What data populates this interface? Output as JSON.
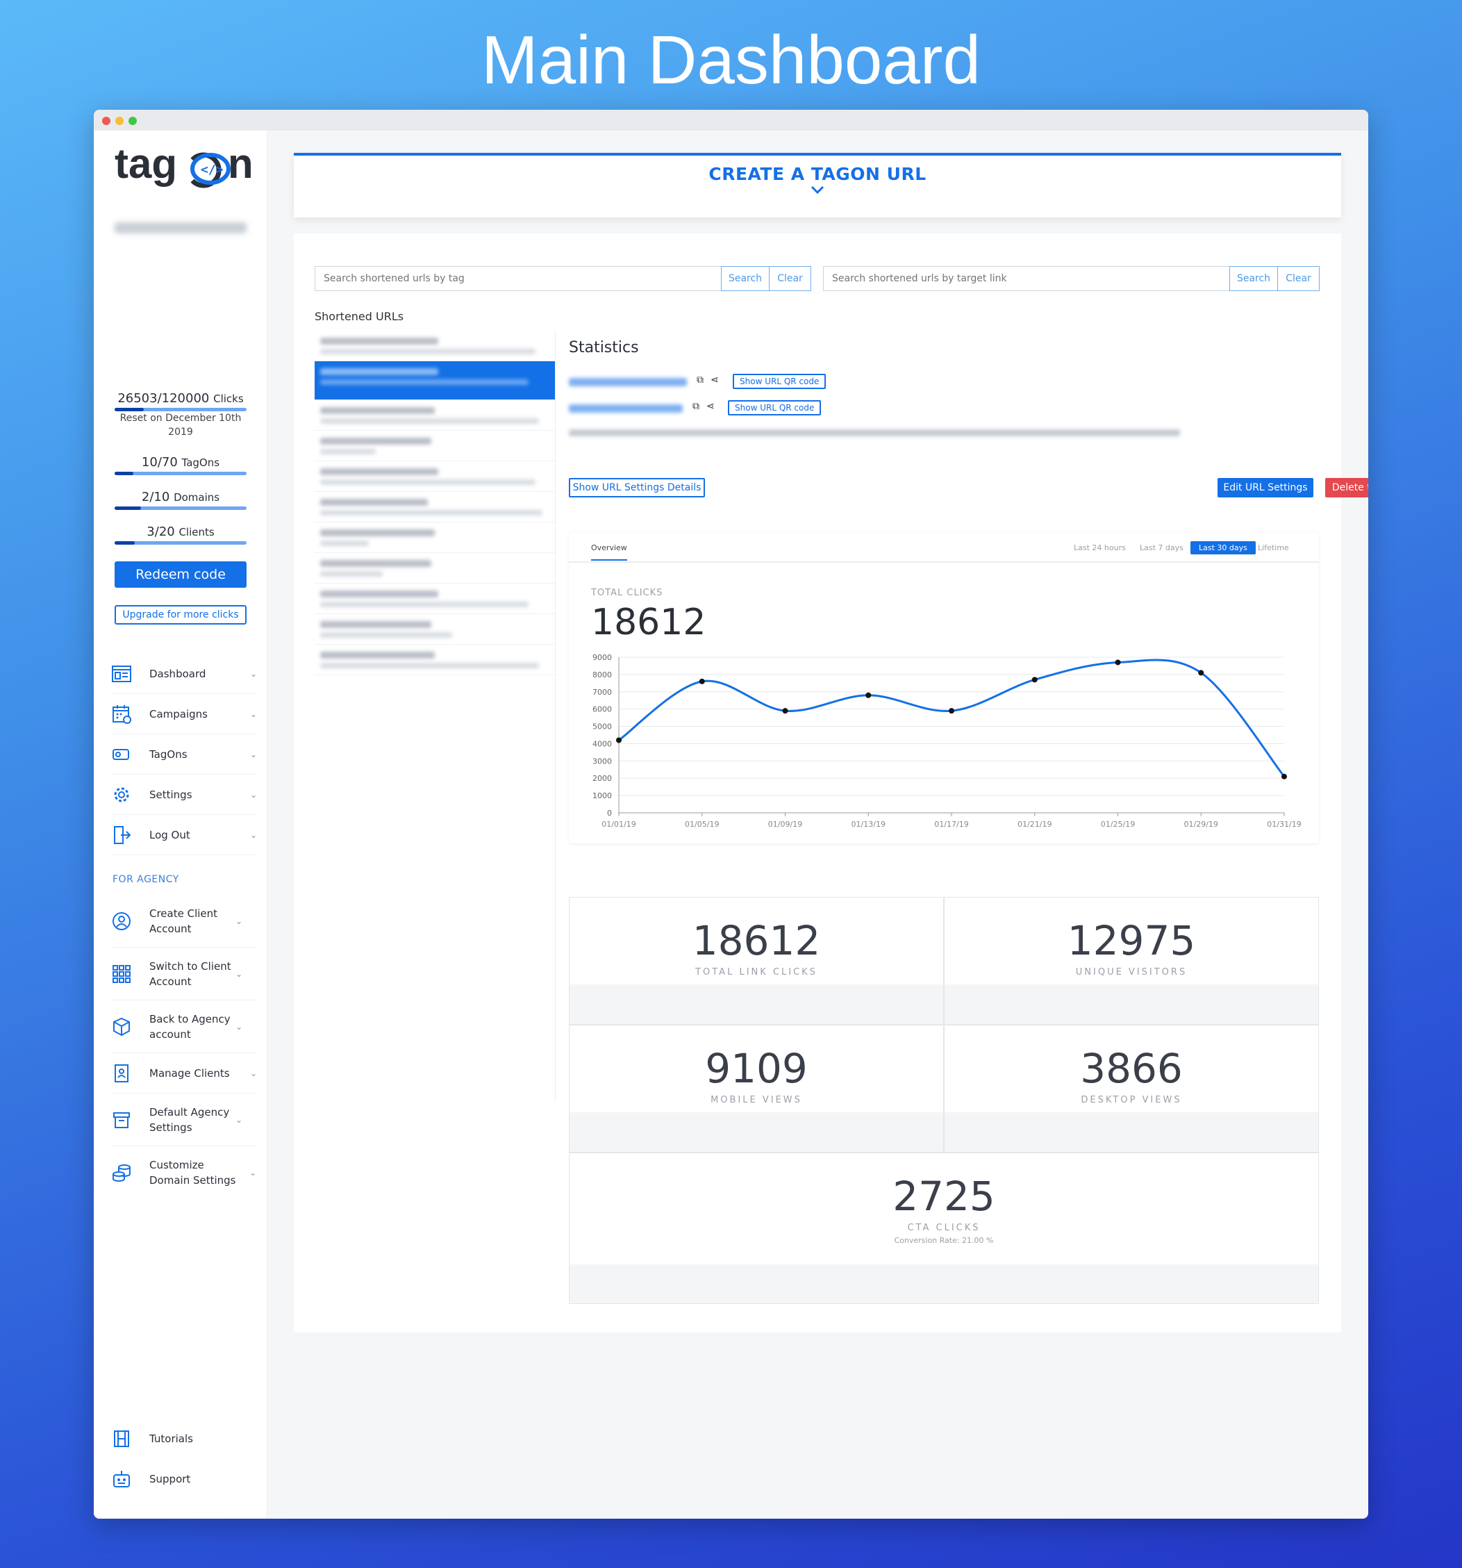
{
  "heading": "Main Dashboard",
  "sidebar": {
    "logo_text": "tagOn",
    "clicks": {
      "value": "26503/120000",
      "unit": "Clicks",
      "fraction": 0.22,
      "reset": "Reset on December 10th 2019"
    },
    "tagons": {
      "value": "10/70",
      "unit": "TagOns",
      "fraction": 0.14
    },
    "domains": {
      "value": "2/10",
      "unit": "Domains",
      "fraction": 0.2
    },
    "clients": {
      "value": "3/20",
      "unit": "Clients",
      "fraction": 0.15
    },
    "redeem_label": "Redeem code",
    "upgrade_label": "Upgrade for more clicks",
    "nav": [
      {
        "label": "Dashboard",
        "icon": "dashboard-icon"
      },
      {
        "label": "Campaigns",
        "icon": "calendar-icon"
      },
      {
        "label": "TagOns",
        "icon": "tag-icon"
      },
      {
        "label": "Settings",
        "icon": "gear-icon"
      },
      {
        "label": "Log Out",
        "icon": "logout-icon"
      }
    ],
    "agency_heading": "FOR AGENCY",
    "agency_nav": [
      {
        "label": "Create Client Account",
        "icon": "user-circle-icon"
      },
      {
        "label": "Switch to Client Account",
        "icon": "grid-icon"
      },
      {
        "label": "Back to Agency account",
        "icon": "box-icon"
      },
      {
        "label": "Manage Clients",
        "icon": "clipboard-user-icon"
      },
      {
        "label": "Default Agency Settings",
        "icon": "archive-icon"
      },
      {
        "label": "Customize Domain Settings",
        "icon": "coins-icon"
      }
    ],
    "bottom": [
      {
        "label": "Tutorials",
        "icon": "film-icon"
      },
      {
        "label": "Support",
        "icon": "robot-icon"
      }
    ]
  },
  "create": {
    "title": "CREATE A TAGON URL"
  },
  "search": {
    "tag_placeholder": "Search shortened urls by tag",
    "target_placeholder": "Search shortened urls by target link",
    "search_label": "Search",
    "clear_label": "Clear"
  },
  "list": {
    "title": "Shortened URLs"
  },
  "stats": {
    "title": "Statistics",
    "qr_label": "Show URL QR code",
    "settings_details_label": "Show URL Settings Details",
    "edit_label": "Edit URL Settings",
    "delete_label": "Delete this URL"
  },
  "overview": {
    "tab": "Overview",
    "ranges": [
      "Last 24 hours",
      "Last 7 days",
      "Last 30 days",
      "Lifetime"
    ],
    "active_range": "Last 30 days",
    "total_clicks_label": "TOTAL CLICKS",
    "total_clicks": "18612"
  },
  "chart_data": {
    "type": "line",
    "x": [
      "01/01/19",
      "01/05/19",
      "01/09/19",
      "01/13/19",
      "01/17/19",
      "01/21/19",
      "01/25/19",
      "01/29/19",
      "01/31/19"
    ],
    "values": [
      4200,
      7600,
      5900,
      6800,
      5900,
      7700,
      8700,
      8100,
      2100
    ],
    "ylim": [
      0,
      9000
    ],
    "yticks": [
      0,
      1000,
      2000,
      3000,
      4000,
      5000,
      6000,
      7000,
      8000,
      9000
    ],
    "color": "#1470e6",
    "grid": true
  },
  "kpis": [
    {
      "value": "18612",
      "label": "TOTAL LINK CLICKS"
    },
    {
      "value": "12975",
      "label": "UNIQUE VISITORS"
    },
    {
      "value": "9109",
      "label": "MOBILE VIEWS"
    },
    {
      "value": "3866",
      "label": "DESKTOP VIEWS"
    },
    {
      "value": "2725",
      "label": "CTA CLICKS",
      "sub": "Conversion Rate: 21.00 %"
    }
  ]
}
